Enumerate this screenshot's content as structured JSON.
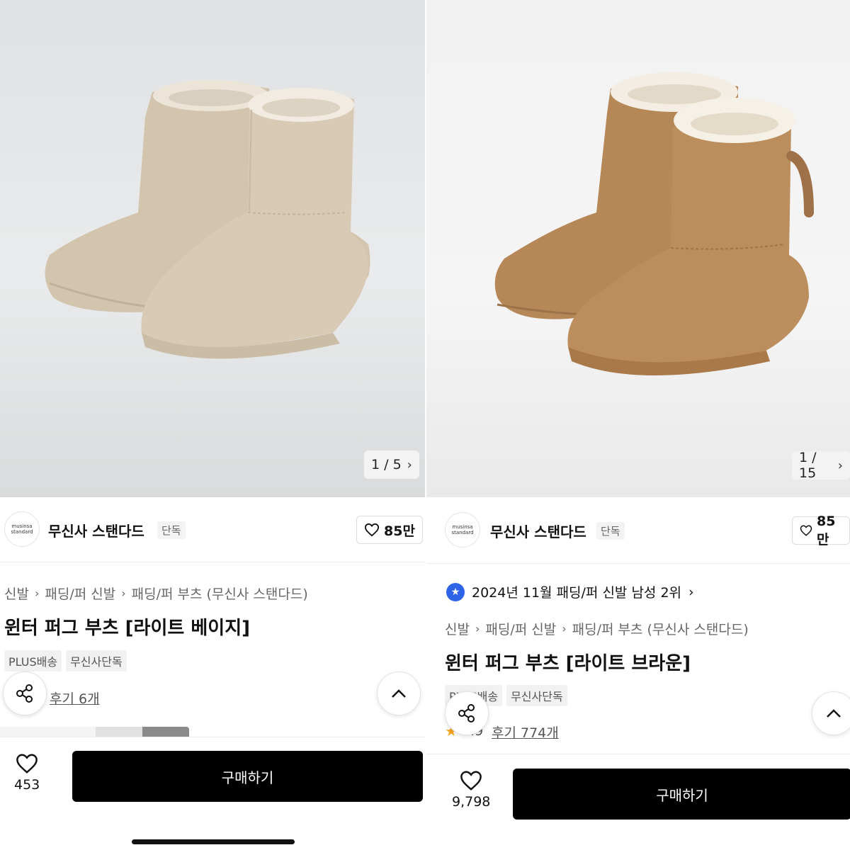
{
  "left": {
    "counter": {
      "current": "1",
      "total": "5",
      "text": "1 / 5"
    },
    "brand": {
      "logo_line1": "musinsa",
      "logo_line2": "standard",
      "name": "무신사 스탠다드",
      "tag": "단독"
    },
    "likes_pill": "85만",
    "breadcrumb": [
      "신발",
      "패딩/퍼 신발",
      "패딩/퍼 부츠 (무신사 스탠다드)"
    ],
    "title": "윈터 퍼그 부츠 [라이트 베이지]",
    "chips": [
      "PLUS배송",
      "무신사단독"
    ],
    "reviews": "후기 6개",
    "wish_count": "453",
    "buy_label": "구매하기",
    "product_color": "#d5c6b0"
  },
  "right": {
    "counter": {
      "current": "1",
      "total": "15",
      "text": "1 / 15"
    },
    "brand": {
      "logo_line1": "musinsa",
      "logo_line2": "standard",
      "name": "무신사 스탠다드",
      "tag": "단독"
    },
    "likes_pill": "85만",
    "ranking": "2024년 11월 패딩/퍼 신발 남성 2위",
    "breadcrumb": [
      "신발",
      "패딩/퍼 신발",
      "패딩/퍼 부츠 (무신사 스탠다드)"
    ],
    "title": "윈터 퍼그 부츠 [라이트 브라운]",
    "chips": [
      "PLUS배송",
      "무신사단독"
    ],
    "rating_partial": "4.9",
    "reviews": "후기 774개",
    "wish_count": "9,798",
    "buy_label": "구매하기",
    "product_color": "#b98a5a"
  },
  "icons": {
    "heart": "heart-icon",
    "share": "share-icon",
    "chevron_up": "chevron-up-icon",
    "chevron_right": "chevron-right-icon",
    "rank_badge": "star-badge-icon"
  },
  "colors": {
    "brand_blue": "#2f64e8",
    "buy_button": "#000000",
    "star": "#f5a623"
  }
}
